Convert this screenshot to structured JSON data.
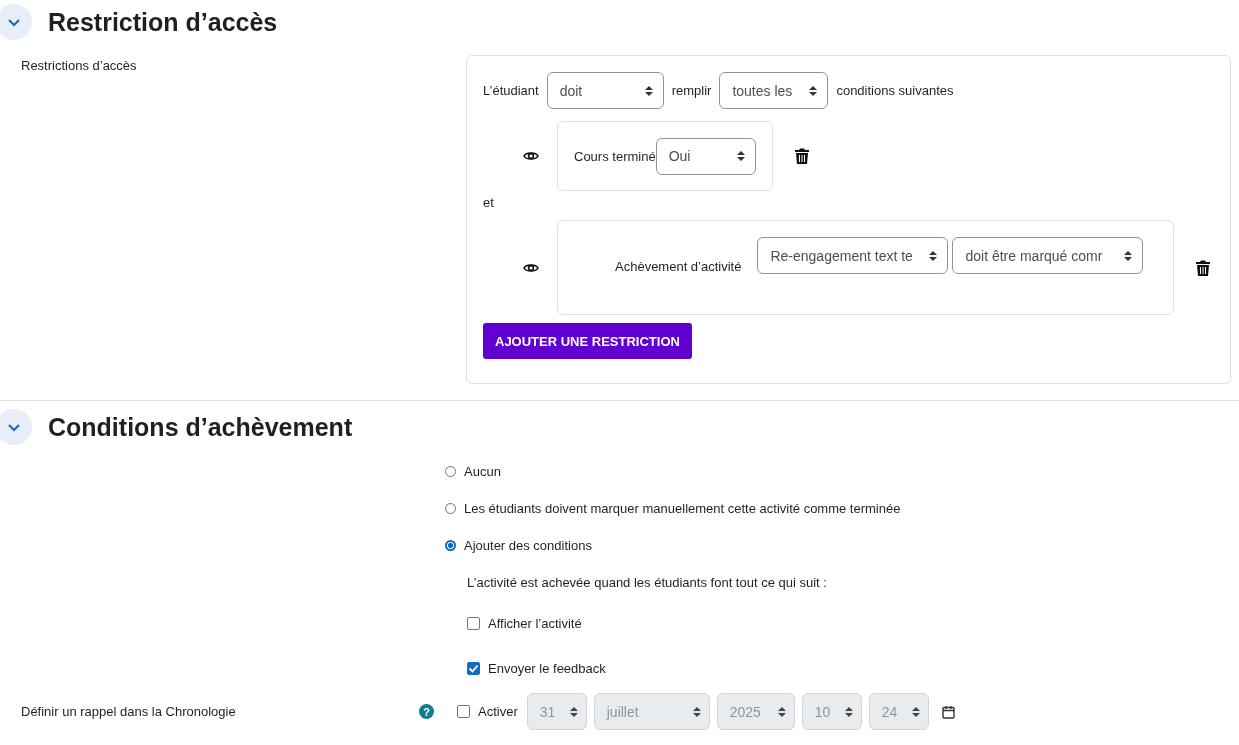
{
  "restriction_section": {
    "title": "Restriction d’accès",
    "expanded": true,
    "label": "Restrictions d’accès",
    "header_row": {
      "prefix": "L’étudiant",
      "mode_select": "doit",
      "middle": "remplir",
      "scope_select": "toutes les",
      "suffix": "conditions suivantes"
    },
    "conditions": [
      {
        "kind": "course",
        "visible": true,
        "label": "Cours terminé",
        "selects": [
          "Oui"
        ]
      },
      {
        "kind": "activity",
        "visible": true,
        "label": "Achèvement d’activité",
        "selects": [
          "Re-engagement text te",
          "doit être marqué comr"
        ]
      }
    ],
    "connector": "et",
    "add_button": "AJOUTER UNE RESTRICTION"
  },
  "completion_section": {
    "title": "Conditions d’achèvement",
    "expanded": true,
    "options": [
      {
        "label": "Aucun",
        "selected": false
      },
      {
        "label": "Les étudiants doivent marquer manuellement cette activité comme terminée",
        "selected": false
      },
      {
        "label": "Ajouter des conditions",
        "selected": true
      }
    ],
    "description": "L’activité est achevée quand les étudiants font tout ce qui suit :",
    "conditions": [
      {
        "label": "Afficher l’activité",
        "checked": false
      },
      {
        "label": "Envoyer le feedback",
        "checked": true
      }
    ],
    "reminder": {
      "label": "Définir un rappel dans la Chronologie",
      "help": "?",
      "enable": {
        "label": "Activer",
        "checked": false
      },
      "date_fields": [
        {
          "value": "31",
          "disabled": true
        },
        {
          "value": "juillet",
          "disabled": true
        },
        {
          "value": "2025",
          "disabled": true
        },
        {
          "value": "10",
          "disabled": true
        },
        {
          "value": "24",
          "disabled": true
        }
      ]
    }
  }
}
